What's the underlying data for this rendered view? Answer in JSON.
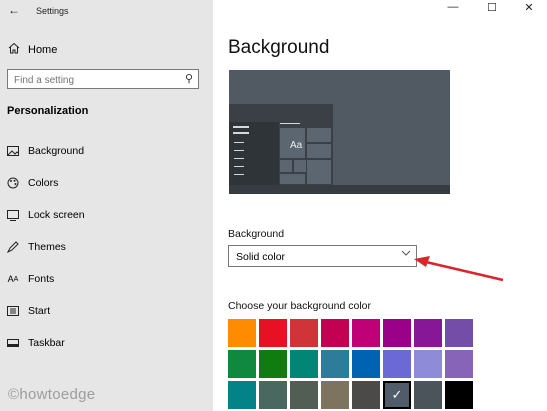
{
  "window": {
    "title": "Settings",
    "back_glyph": "←",
    "minimize_glyph": "—",
    "maximize_glyph": "☐",
    "close_glyph": "✕"
  },
  "sidebar": {
    "home_label": "Home",
    "search_placeholder": "Find a setting",
    "section_title": "Personalization",
    "items": [
      {
        "label": "Background",
        "icon": "image-icon"
      },
      {
        "label": "Colors",
        "icon": "palette-icon"
      },
      {
        "label": "Lock screen",
        "icon": "lock-screen-icon"
      },
      {
        "label": "Themes",
        "icon": "themes-icon"
      },
      {
        "label": "Fonts",
        "icon": "fonts-icon"
      },
      {
        "label": "Start",
        "icon": "start-icon"
      },
      {
        "label": "Taskbar",
        "icon": "taskbar-icon"
      }
    ]
  },
  "watermark": "©howtoedge",
  "main": {
    "title": "Background",
    "preview_text": "Aa",
    "background_label": "Background",
    "background_value": "Solid color",
    "choose_color_label": "Choose your background color",
    "swatch_colors": [
      [
        "#ff8c00",
        "#e81123",
        "#d13438",
        "#c30052",
        "#bf0077",
        "#9a0089",
        "#881798",
        "#744da9"
      ],
      [
        "#10893e",
        "#107c10",
        "#018574",
        "#2d7d9a",
        "#0063b1",
        "#6b69d6",
        "#8e8cd8",
        "#8764b8"
      ],
      [
        "#038387",
        "#486860",
        "#525e54",
        "#7e735f",
        "#4c4a48",
        "#515c6b",
        "#4a5459",
        "#000000"
      ]
    ],
    "selected_swatch": {
      "row": 2,
      "col": 5
    }
  },
  "colors": {
    "sidebar_bg": "#e6e6e6",
    "annotation_arrow": "#d9262a"
  }
}
